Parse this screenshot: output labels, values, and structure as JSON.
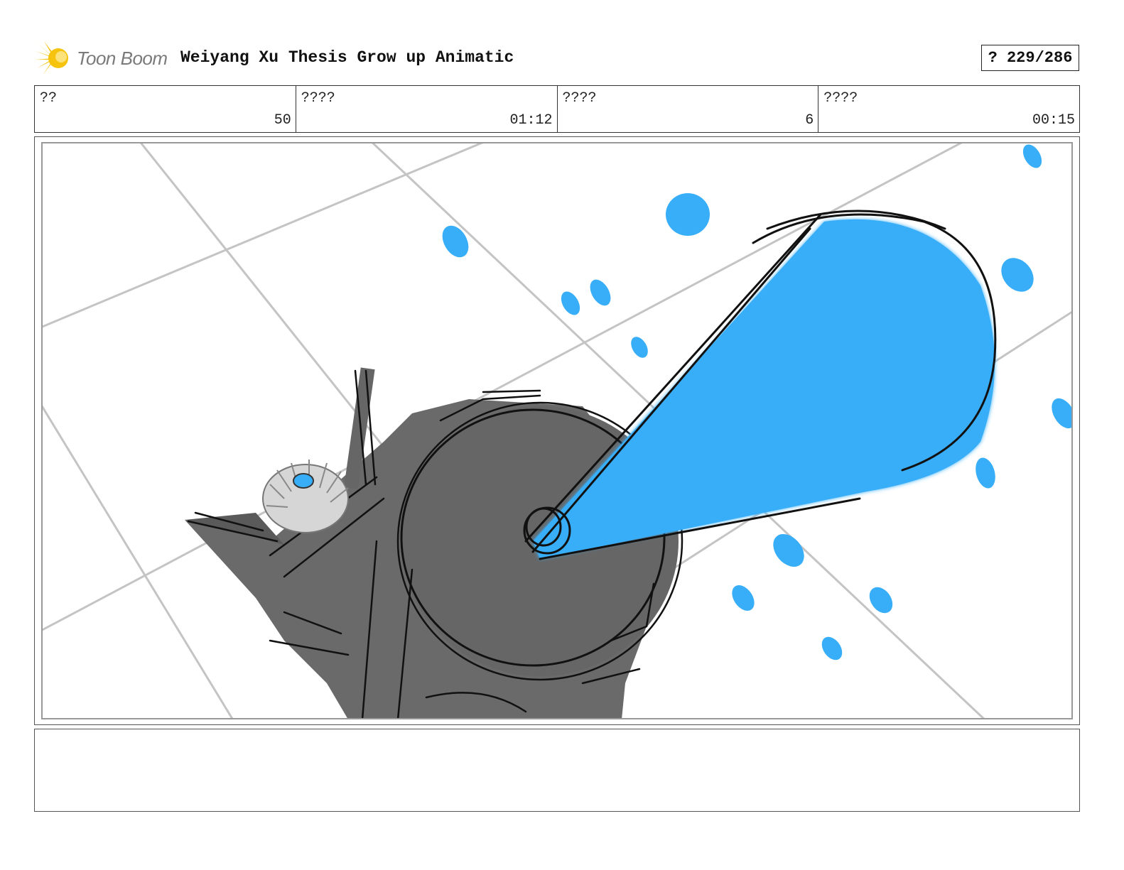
{
  "header": {
    "logo_text": "Toon Boom",
    "title": "Weiyang Xu Thesis Grow up Animatic",
    "page_counter": "? 229/286"
  },
  "info": [
    {
      "label": "??",
      "value": "50"
    },
    {
      "label": "????",
      "value": "01:12"
    },
    {
      "label": "????",
      "value": "6"
    },
    {
      "label": "????",
      "value": "00:15"
    }
  ],
  "colors": {
    "accent_blue": "#38aef8",
    "sketch_gray": "#666666",
    "grid_gray": "#c4c4c4",
    "logo_yellow": "#f6c40f"
  },
  "panel": {
    "icon": "storyboard-sketch-image"
  },
  "notes": {
    "text": ""
  }
}
